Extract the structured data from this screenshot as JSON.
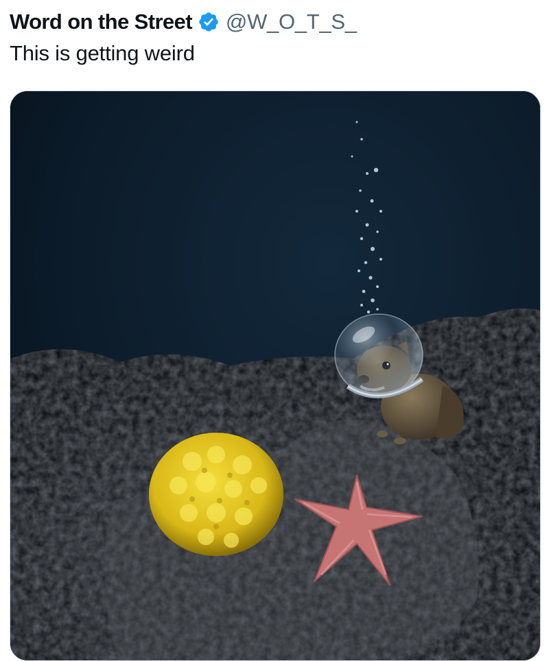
{
  "tweet": {
    "author_name": "Word on the Street",
    "verified_icon": "verified-badge-icon",
    "handle": "@W_O_T_S_",
    "text": "This is getting weird",
    "media": {
      "subject": "squirrel-in-diving-helmet-underwater",
      "elements": [
        "squirrel",
        "bubble-helmet",
        "air-bubbles",
        "yellow-sea-sponge",
        "pink-starfish",
        "dark-seafloor-rocks"
      ]
    }
  },
  "colors": {
    "text_primary": "#0f1419",
    "text_secondary": "#536471",
    "verified_blue": "#1d9bf0",
    "media_border": "#cfd9de"
  }
}
